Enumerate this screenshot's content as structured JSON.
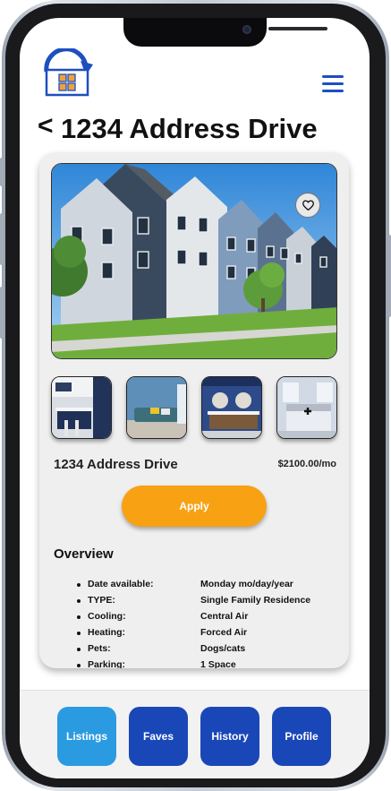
{
  "header": {
    "logo_icon": "house-refresh-logo",
    "menu_icon": "hamburger-icon",
    "accent_color": "#1d4fbf"
  },
  "page": {
    "back_label": "<",
    "title": "1234 Address Drive"
  },
  "listing": {
    "name": "1234 Address Drive",
    "price": "$2100.00/mo",
    "favorite_icon": "heart-icon",
    "apply_label": "Apply",
    "apply_color": "#f7a113",
    "overview_heading": "Overview",
    "details": [
      {
        "label": "Date available:",
        "value": "Monday mo/day/year"
      },
      {
        "label": "TYPE:",
        "value": "Single Family Residence"
      },
      {
        "label": "Cooling:",
        "value": "Central Air"
      },
      {
        "label": "Heating:",
        "value": "Forced Air"
      },
      {
        "label": "Pets:",
        "value": "Dogs/cats"
      },
      {
        "label": "Parking:",
        "value": "1 Space"
      }
    ]
  },
  "nav": {
    "items": [
      {
        "label": "Listings",
        "color": "#2a9be0"
      },
      {
        "label": "Faves",
        "color": "#1a47b8"
      },
      {
        "label": "History",
        "color": "#1a47b8"
      },
      {
        "label": "Profile",
        "color": "#1a47b8"
      }
    ]
  }
}
